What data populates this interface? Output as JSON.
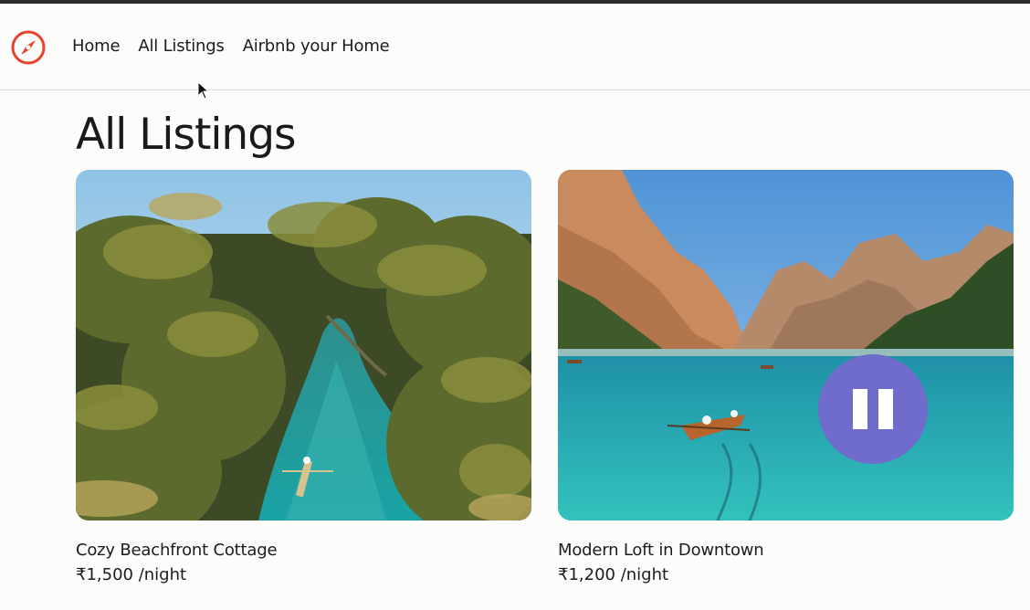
{
  "nav": {
    "logo_icon": "compass-icon",
    "links": [
      "Home",
      "All Listings",
      "Airbnb your Home"
    ]
  },
  "page": {
    "title": "All Listings"
  },
  "listings": [
    {
      "title": "Cozy Beachfront Cottage",
      "price": "₹1,500 /night",
      "image": "tropical palm river with canoe"
    },
    {
      "title": "Modern Loft in Downtown",
      "price": "₹1,200 /night",
      "image": "mountain lake with rowboat",
      "media_control": "pause-icon"
    }
  ],
  "colors": {
    "brand": "#e8412d",
    "pause_button": "#6f6ccc",
    "water": "#1fa3a7"
  }
}
